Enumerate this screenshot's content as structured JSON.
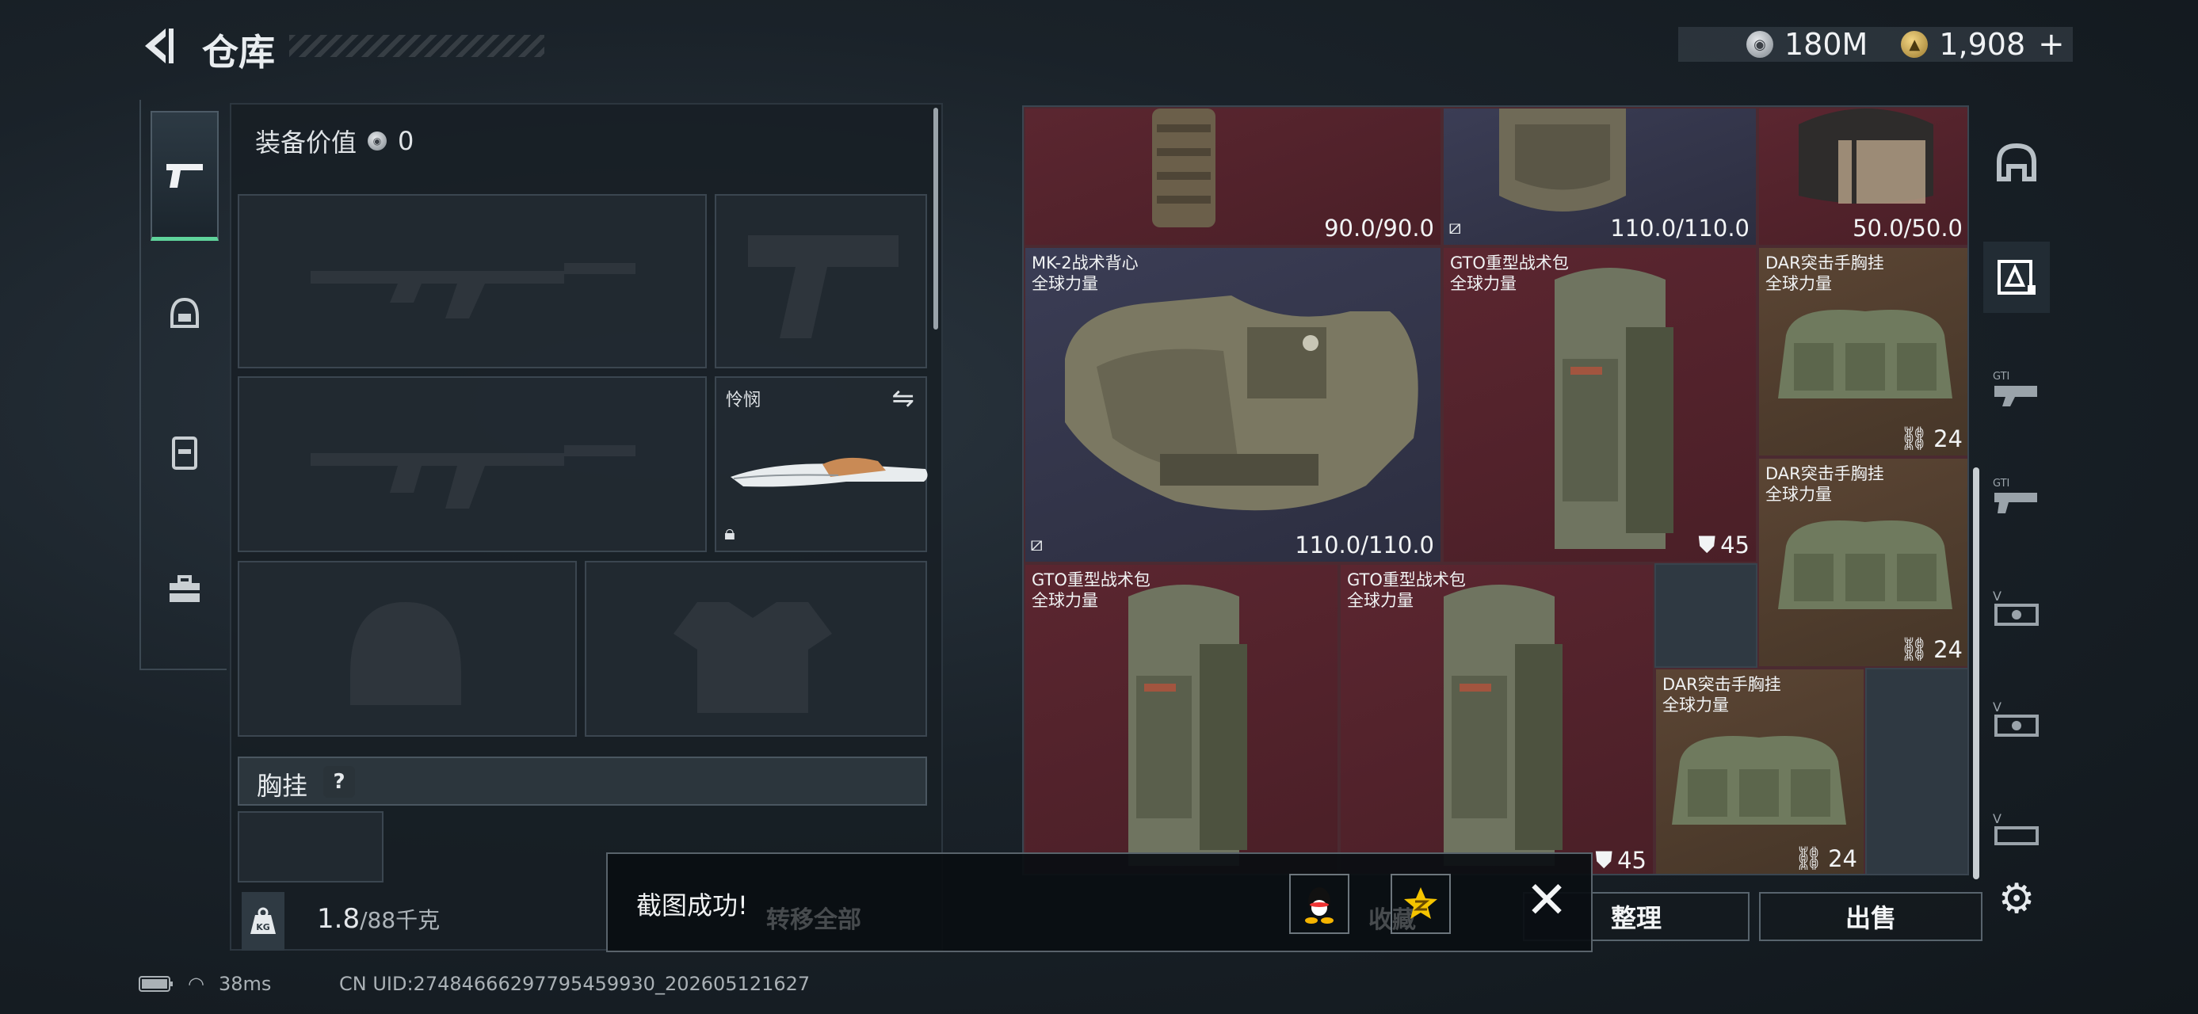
{
  "header": {
    "title": "仓库",
    "back_icon": "back-arrow-icon"
  },
  "currency": {
    "silver_value": "180M",
    "gold_value": "1,908",
    "plus": "+"
  },
  "categories": [
    {
      "icon": "pistol-icon",
      "active": true
    },
    {
      "icon": "helmet-icon",
      "active": false
    },
    {
      "icon": "backpack-icon",
      "active": false
    },
    {
      "icon": "toolbox-icon",
      "active": false
    }
  ],
  "loadout": {
    "equip_value_label": "装备价值",
    "equip_value": "0",
    "knife_name": "怜悯",
    "chest_label": "胸挂",
    "chest_help": "?",
    "weight": "1.8",
    "weight_max": "/88千克",
    "kg_badge": "KG"
  },
  "grid_items": {
    "top1_dur": "90.0/90.0",
    "top2_dur": "110.0/110.0",
    "top3_dur": "50.0/50.0",
    "vest_name": "MK-2战术背心",
    "vest_sub": "全球力量",
    "vest_dur": "110.0/110.0",
    "gto_name": "GTO重型战术包",
    "gto_sub": "全球力量",
    "gto_count": "45",
    "dar_name": "DAR突击手胸挂",
    "dar_sub": "全球力量",
    "dar_count": "24",
    "gto2_name": "GTO重型战术包",
    "gto2_sub": "全球力量",
    "gto2_count": "45",
    "gto3_name": "GTO重型战术包",
    "gto3_sub": "全球力量",
    "gto3_count": "45",
    "dar2_name": "DAR突击手胸挂",
    "dar2_sub": "全球力量",
    "dar2_count": "24",
    "dar3_name": "DAR突击手胸挂",
    "dar3_sub": "全球力量",
    "dar3_count": "24"
  },
  "side_tabs": [
    "helmet-tab-icon",
    "gti-armor-tab-icon",
    "gti-tab-2-icon",
    "gti-tab-3-icon",
    "v-tab-1-icon",
    "v-tab-2-icon",
    "v-tab-3-icon"
  ],
  "actions": {
    "transfer_all": "转移全部",
    "collect": "收藏",
    "sort": "整理",
    "sell": "出售"
  },
  "toast": {
    "text": "截图成功!"
  },
  "status": {
    "ping": "38ms",
    "uid": "CN UID:27484666297795459930_202605121627"
  },
  "colors": {
    "accent_green": "#5fd39b",
    "item_red": "#5b2630",
    "item_blue": "#3b3d55",
    "item_brown": "#5b4534"
  }
}
